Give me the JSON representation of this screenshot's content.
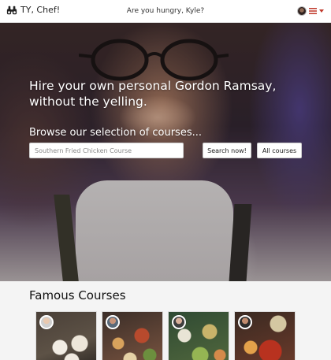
{
  "navbar": {
    "brand_name": "TY, Chef!",
    "brand_icon": "binoculars-icon",
    "greeting": "Are you hungry, Kyle?",
    "menu_icon": "hamburger-menu-icon",
    "accent_color": "#c0392b"
  },
  "hero": {
    "heading": "Hire your own personal Gordon Ramsay, without the yelling.",
    "browse_label": "Browse our selection of courses...",
    "search": {
      "placeholder": "Southern Fried Chicken Course",
      "value": ""
    },
    "search_button": "Search now!",
    "all_courses_button": "All courses"
  },
  "famous_courses": {
    "title": "Famous Courses",
    "cards": [
      {
        "image": "dumplings-photo",
        "chef_avatar": "chef-avatar"
      },
      {
        "image": "seafood-platter-photo",
        "chef_avatar": "chef-avatar"
      },
      {
        "image": "salad-bowls-photo",
        "chef_avatar": "chef-avatar"
      },
      {
        "image": "hotpot-dishes-photo",
        "chef_avatar": "chef-avatar"
      }
    ]
  }
}
